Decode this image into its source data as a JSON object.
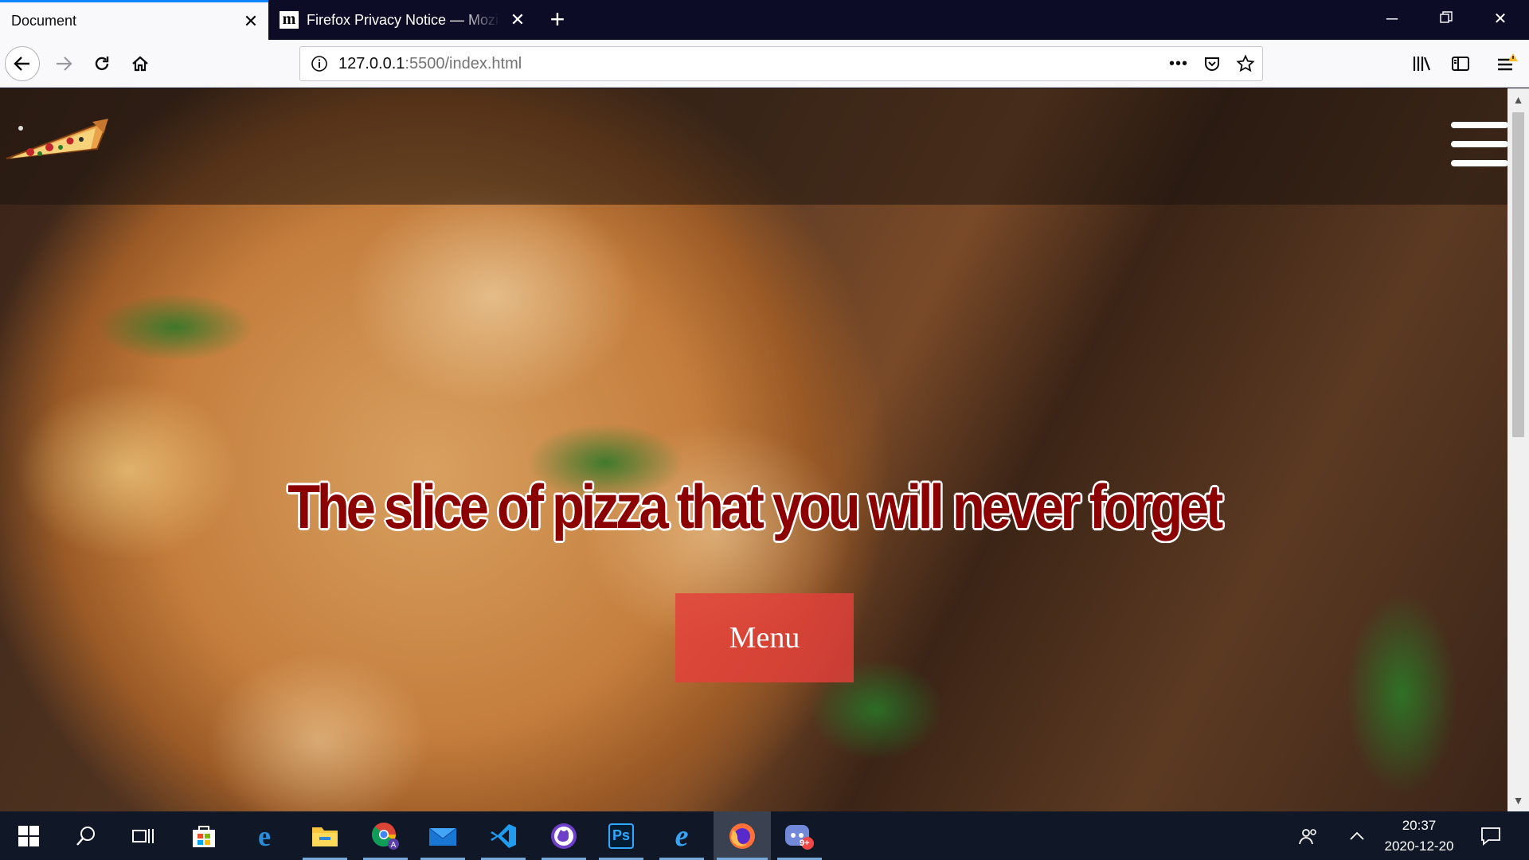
{
  "browser": {
    "tabs": [
      {
        "title": "Document",
        "active": true
      },
      {
        "title": "Firefox Privacy Notice — Mozilla",
        "favicon": "m",
        "active": false
      }
    ],
    "url_host": "127.0.0.1",
    "url_path": ":5500/index.html",
    "more_label": "•••"
  },
  "page": {
    "headline": "The slice of pizza that you will never forget",
    "menu_button": "Menu"
  },
  "taskbar": {
    "time": "20:37",
    "date": "2020-12-20",
    "apps": [
      "windows-start",
      "search",
      "task-view",
      "microsoft-store",
      "edge",
      "file-explorer",
      "chrome",
      "mail",
      "vscode",
      "github-desktop",
      "photoshop",
      "internet-explorer",
      "firefox",
      "discord"
    ],
    "photoshop_label": "Ps",
    "discord_badge": "9+"
  },
  "colors": {
    "tabstrip": "#0c0c27",
    "headline": "#8b0000",
    "menu_button": "#e4403a",
    "accent": "#0a84ff"
  }
}
